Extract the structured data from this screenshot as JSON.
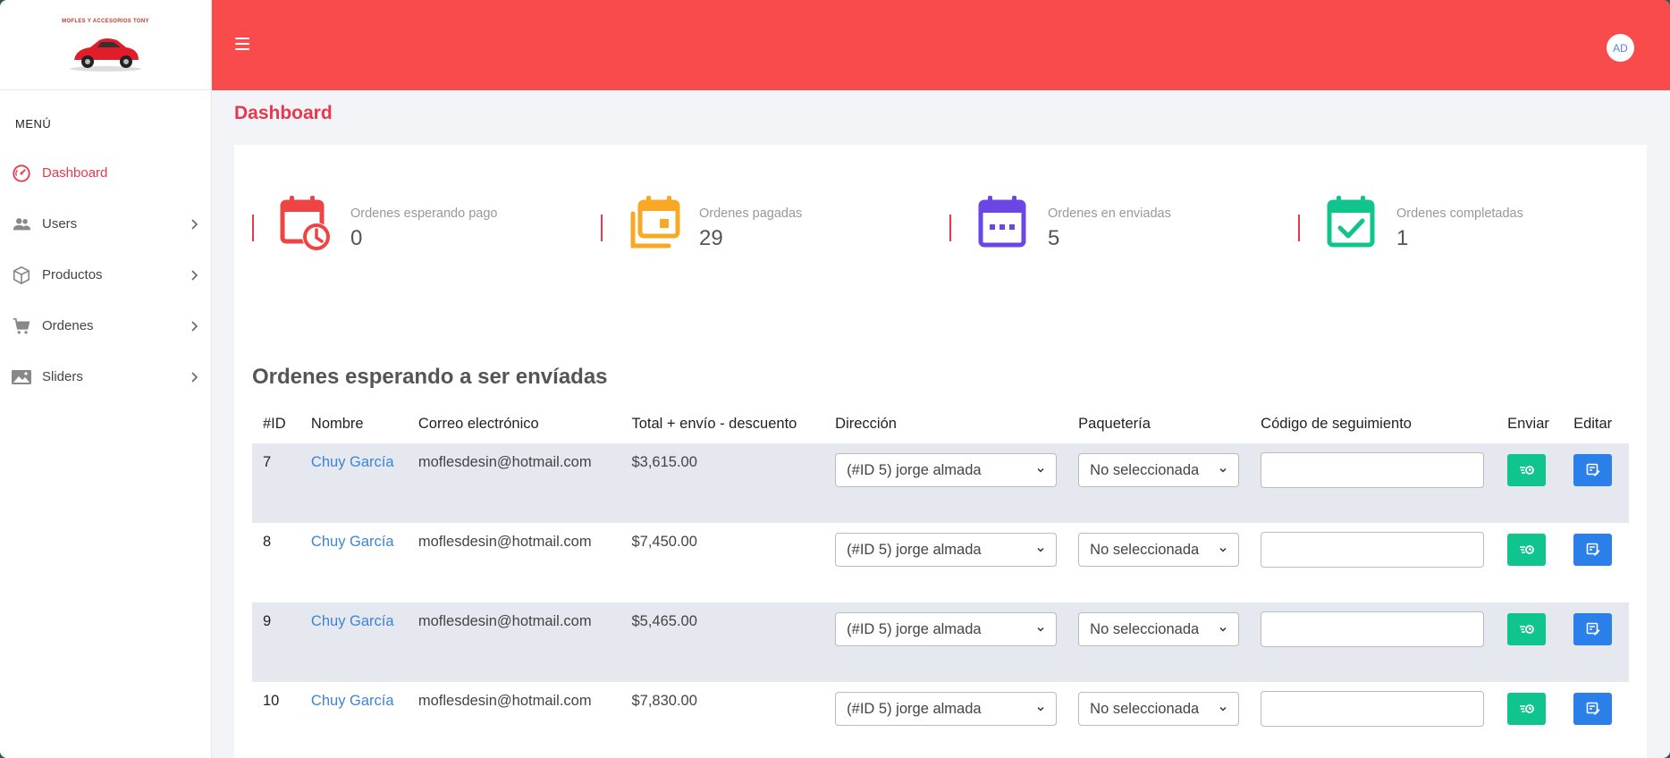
{
  "brand": {
    "logo_text": "MOFLES Y ACCESORIOS TONY"
  },
  "sidebar": {
    "menu_title": "MENÚ",
    "items": [
      {
        "label": "Dashboard",
        "icon": "gauge-icon",
        "active": true
      },
      {
        "label": "Users",
        "icon": "users-icon"
      },
      {
        "label": "Productos",
        "icon": "box-icon"
      },
      {
        "label": "Ordenes",
        "icon": "cart-icon"
      },
      {
        "label": "Sliders",
        "icon": "image-icon"
      }
    ]
  },
  "header": {
    "avatar_initials": "AD"
  },
  "page": {
    "title": "Dashboard"
  },
  "stats": [
    {
      "label": "Ordenes esperando pago",
      "value": "0",
      "icon": "calendar-clock-icon",
      "color": "#ef4444"
    },
    {
      "label": "Ordenes pagadas",
      "value": "29",
      "icon": "calendar-stack-icon",
      "color": "#f9a826"
    },
    {
      "label": "Ordenes en enviadas",
      "value": "5",
      "icon": "calendar-dots-icon",
      "color": "#6b46e5"
    },
    {
      "label": "Ordenes completadas",
      "value": "1",
      "icon": "calendar-check-icon",
      "color": "#10c48d"
    }
  ],
  "orders": {
    "title": "Ordenes esperando a ser envíadas",
    "columns": [
      "#ID",
      "Nombre",
      "Correo electrónico",
      "Total + envío - descuento",
      "Dirección",
      "Paquetería",
      "Código de seguimiento",
      "Enviar",
      "Editar"
    ],
    "rows": [
      {
        "id": "7",
        "name": "Chuy García",
        "email": "moflesdesin@hotmail.com",
        "total": "$3,615.00",
        "address": "(#ID 5) jorge almada",
        "courier": "No seleccionada",
        "tracking": ""
      },
      {
        "id": "8",
        "name": "Chuy García",
        "email": "moflesdesin@hotmail.com",
        "total": "$7,450.00",
        "address": "(#ID 5) jorge almada",
        "courier": "No seleccionada",
        "tracking": ""
      },
      {
        "id": "9",
        "name": "Chuy García",
        "email": "moflesdesin@hotmail.com",
        "total": "$5,465.00",
        "address": "(#ID 5) jorge almada",
        "courier": "No seleccionada",
        "tracking": ""
      },
      {
        "id": "10",
        "name": "Chuy García",
        "email": "moflesdesin@hotmail.com",
        "total": "$7,830.00",
        "address": "(#ID 5) jorge almada",
        "courier": "No seleccionada",
        "tracking": ""
      }
    ]
  },
  "colors": {
    "topbar": "#f94b4b",
    "accent": "#e8384f",
    "link": "#3c84d9",
    "send": "#10c48d",
    "edit": "#2a7fe8"
  }
}
